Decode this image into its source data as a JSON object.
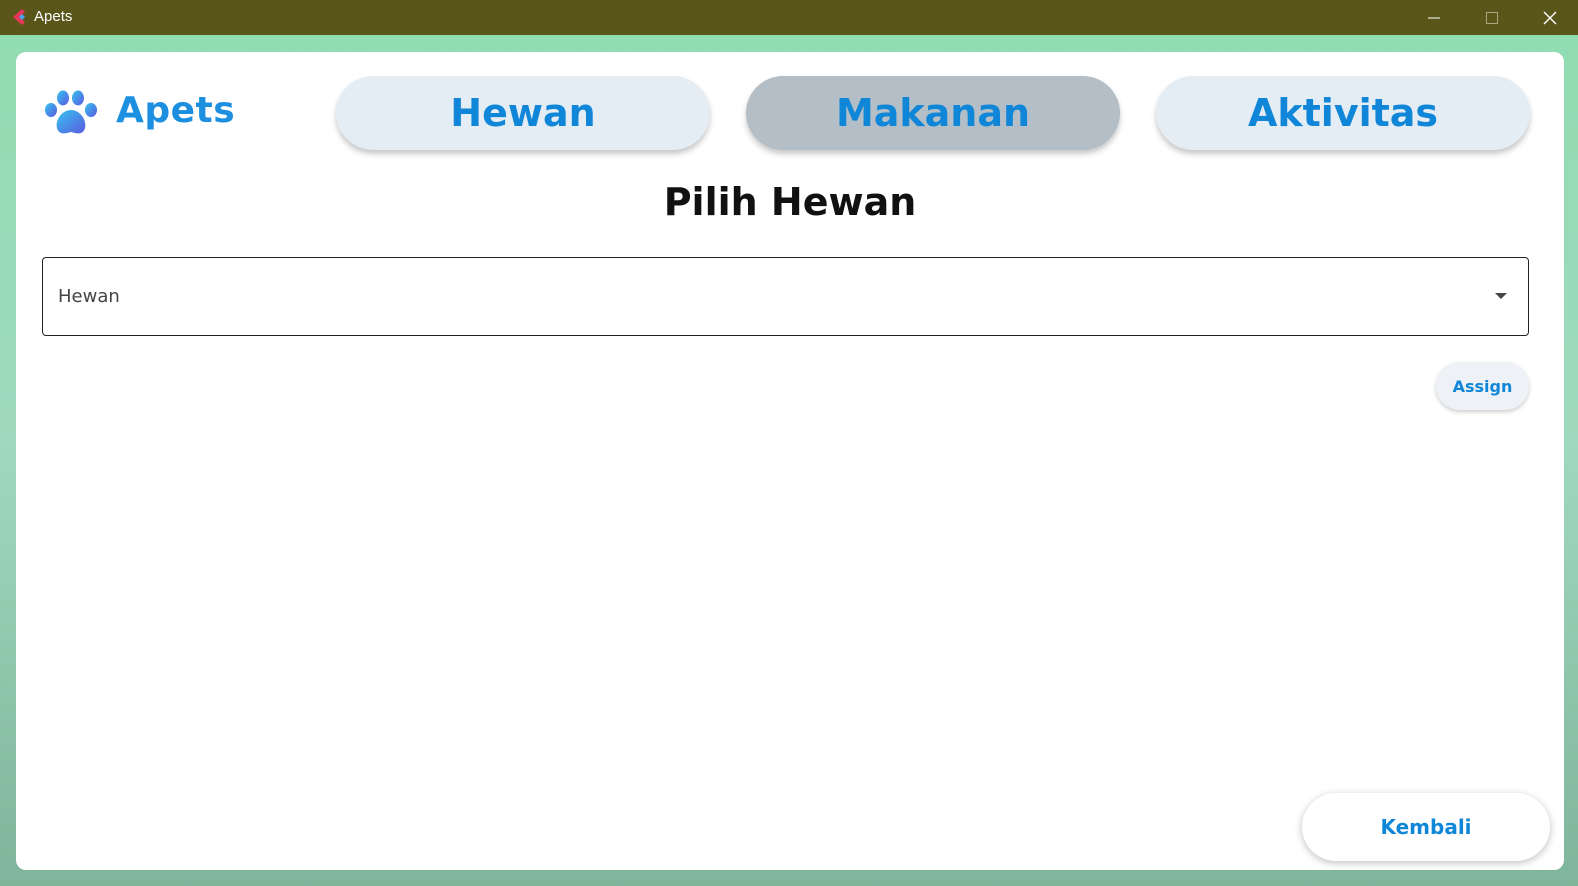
{
  "window": {
    "title": "Apets",
    "controls": {
      "minimize_icon": "minimize-icon",
      "maximize_icon": "maximize-icon",
      "close_icon": "close-icon"
    }
  },
  "header": {
    "brand": "Apets",
    "logo_icon": "paw-icon",
    "nav": [
      {
        "label": "Hewan",
        "active": false
      },
      {
        "label": "Makanan",
        "active": true
      },
      {
        "label": "Aktivitas",
        "active": false
      }
    ]
  },
  "main": {
    "title": "Pilih Hewan",
    "select": {
      "value": "Hewan",
      "icon": "chevron-down-icon"
    },
    "assign_label": "Assign",
    "back_label": "Kembali"
  },
  "colors": {
    "titlebar": "#5a561a",
    "accent": "#0f86d8",
    "nav_bg": "#e4ecf4",
    "nav_active_bg": "#b4bec6"
  }
}
